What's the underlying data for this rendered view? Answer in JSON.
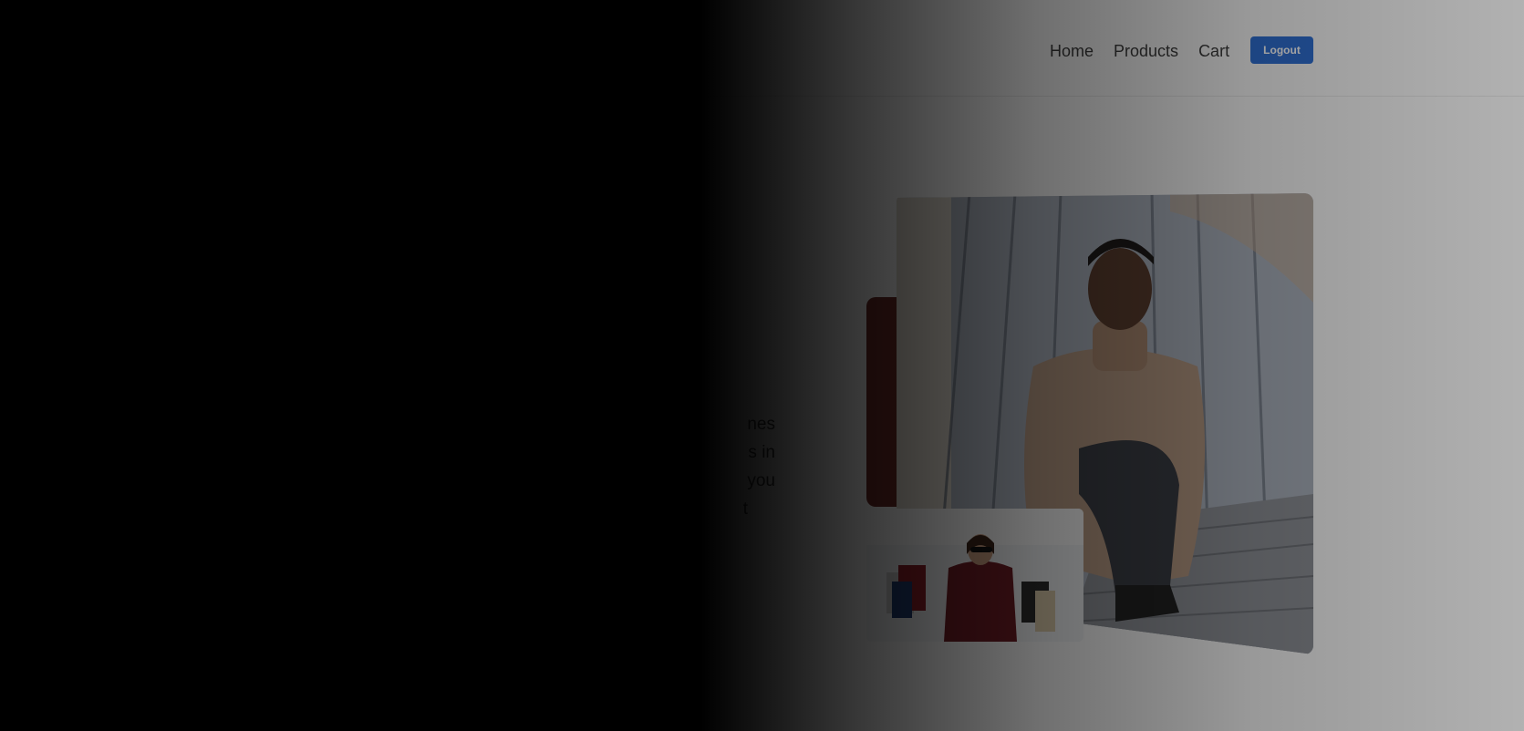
{
  "nav": {
    "items": [
      {
        "label": "Home"
      },
      {
        "label": "Products"
      },
      {
        "label": "Cart"
      }
    ],
    "logout_label": "Logout"
  },
  "hero": {
    "body_lines": [
      "nes",
      "s in",
      "you",
      "t"
    ]
  },
  "colors": {
    "primary_button": "#2f6fd2",
    "accent_block": "#6b2a26"
  }
}
